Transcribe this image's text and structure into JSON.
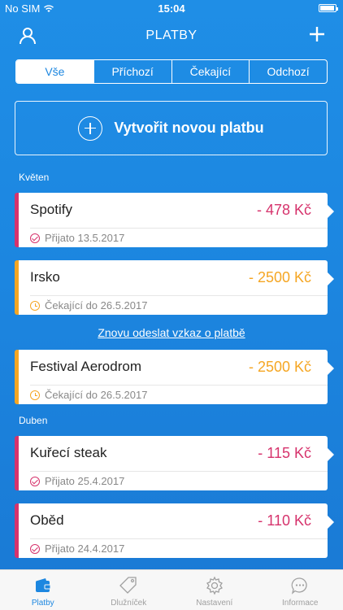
{
  "status_bar": {
    "carrier": "No SIM",
    "time": "15:04"
  },
  "nav": {
    "title": "PLATBY"
  },
  "segments": [
    {
      "label": "Vše",
      "active": true
    },
    {
      "label": "Příchozí",
      "active": false
    },
    {
      "label": "Čekající",
      "active": false
    },
    {
      "label": "Odchozí",
      "active": false
    }
  ],
  "create": {
    "label": "Vytvořit novou platbu"
  },
  "sections": {
    "may": "Květen",
    "april": "Duben"
  },
  "payments": [
    {
      "name": "Spotify",
      "amount": "- 478 Kč",
      "status": "Přijato 13.5.2017",
      "state": "received"
    },
    {
      "name": "Irsko",
      "amount": "- 2500 Kč",
      "status": "Čekající do 26.5.2017",
      "state": "pending"
    },
    {
      "name": "Festival Aerodrom",
      "amount": "- 2500 Kč",
      "status": "Čekající do 26.5.2017",
      "state": "pending"
    },
    {
      "name": "Kuřecí steak",
      "amount": "- 115 Kč",
      "status": "Přijato 25.4.2017",
      "state": "received"
    },
    {
      "name": "Oběd",
      "amount": "- 110 Kč",
      "status": "Přijato 24.4.2017",
      "state": "received"
    }
  ],
  "resend_link": "Znovu odeslat vzkaz o platbě",
  "tabs": [
    {
      "label": "Platby",
      "icon": "wallet-icon",
      "active": true
    },
    {
      "label": "Dlužníček",
      "icon": "tag-icon",
      "active": false
    },
    {
      "label": "Nastavení",
      "icon": "gear-icon",
      "active": false
    },
    {
      "label": "Informace",
      "icon": "chat-icon",
      "active": false
    }
  ],
  "colors": {
    "accent": "#1d87e0",
    "received": "#d6336c",
    "pending": "#f5a623"
  }
}
